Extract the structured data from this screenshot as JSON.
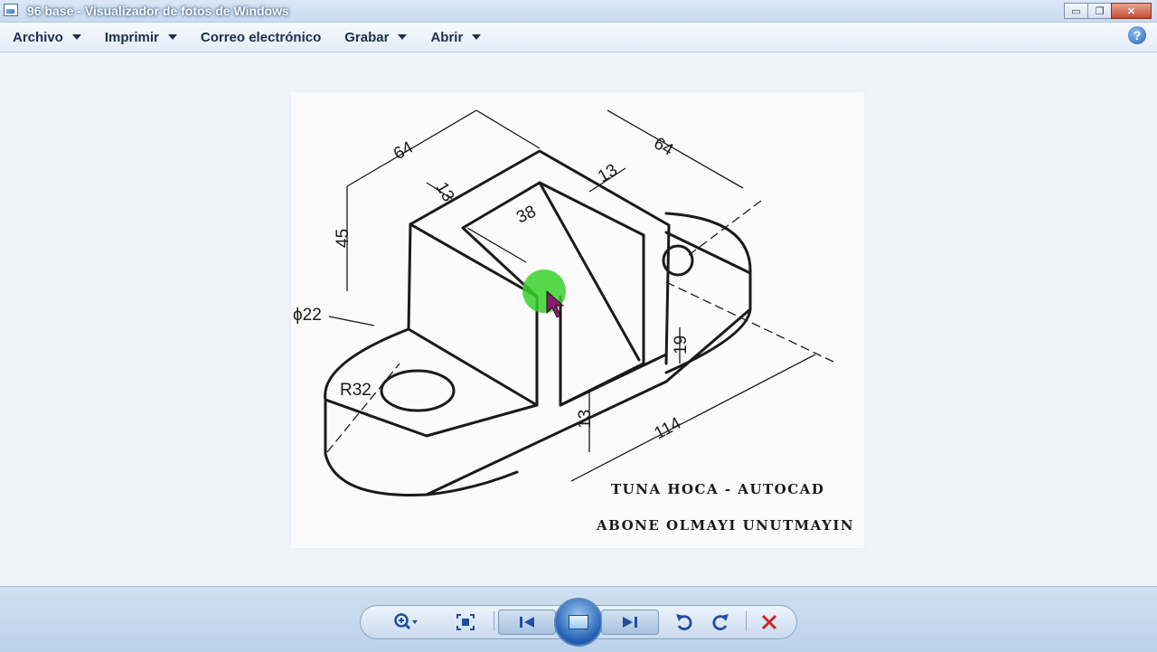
{
  "window": {
    "title": "96 base - Visualizador de fotos de Windows",
    "controls": {
      "minimize": "▭",
      "restore": "❐",
      "close": "✕"
    }
  },
  "menu": {
    "items": [
      {
        "label": "Archivo",
        "has_dropdown": true
      },
      {
        "label": "Imprimir",
        "has_dropdown": true
      },
      {
        "label": "Correo electrónico",
        "has_dropdown": false
      },
      {
        "label": "Grabar",
        "has_dropdown": true
      },
      {
        "label": "Abrir",
        "has_dropdown": true
      }
    ],
    "help_icon": "?"
  },
  "image": {
    "dimensions": [
      "64",
      "64",
      "13",
      "13",
      "38",
      "45",
      "ϕ22",
      "R32",
      "13",
      "19",
      "114"
    ],
    "credit_line1": "TUNA HOCA - AUTOCAD",
    "credit_line2": "ABONE OLMAYI UNUTMAYIN"
  },
  "toolbar": {
    "zoom": "zoom-icon",
    "fit": "fit-window-icon",
    "previous": "previous-icon",
    "slideshow": "slideshow-icon",
    "next": "next-icon",
    "rotate_left": "rotate-counterclockwise-icon",
    "rotate_right": "rotate-clockwise-icon",
    "delete": "delete-icon"
  },
  "colors": {
    "accent": "#1f4f9a",
    "delete": "#c8262a",
    "cursor_highlight": "#37d12c"
  }
}
